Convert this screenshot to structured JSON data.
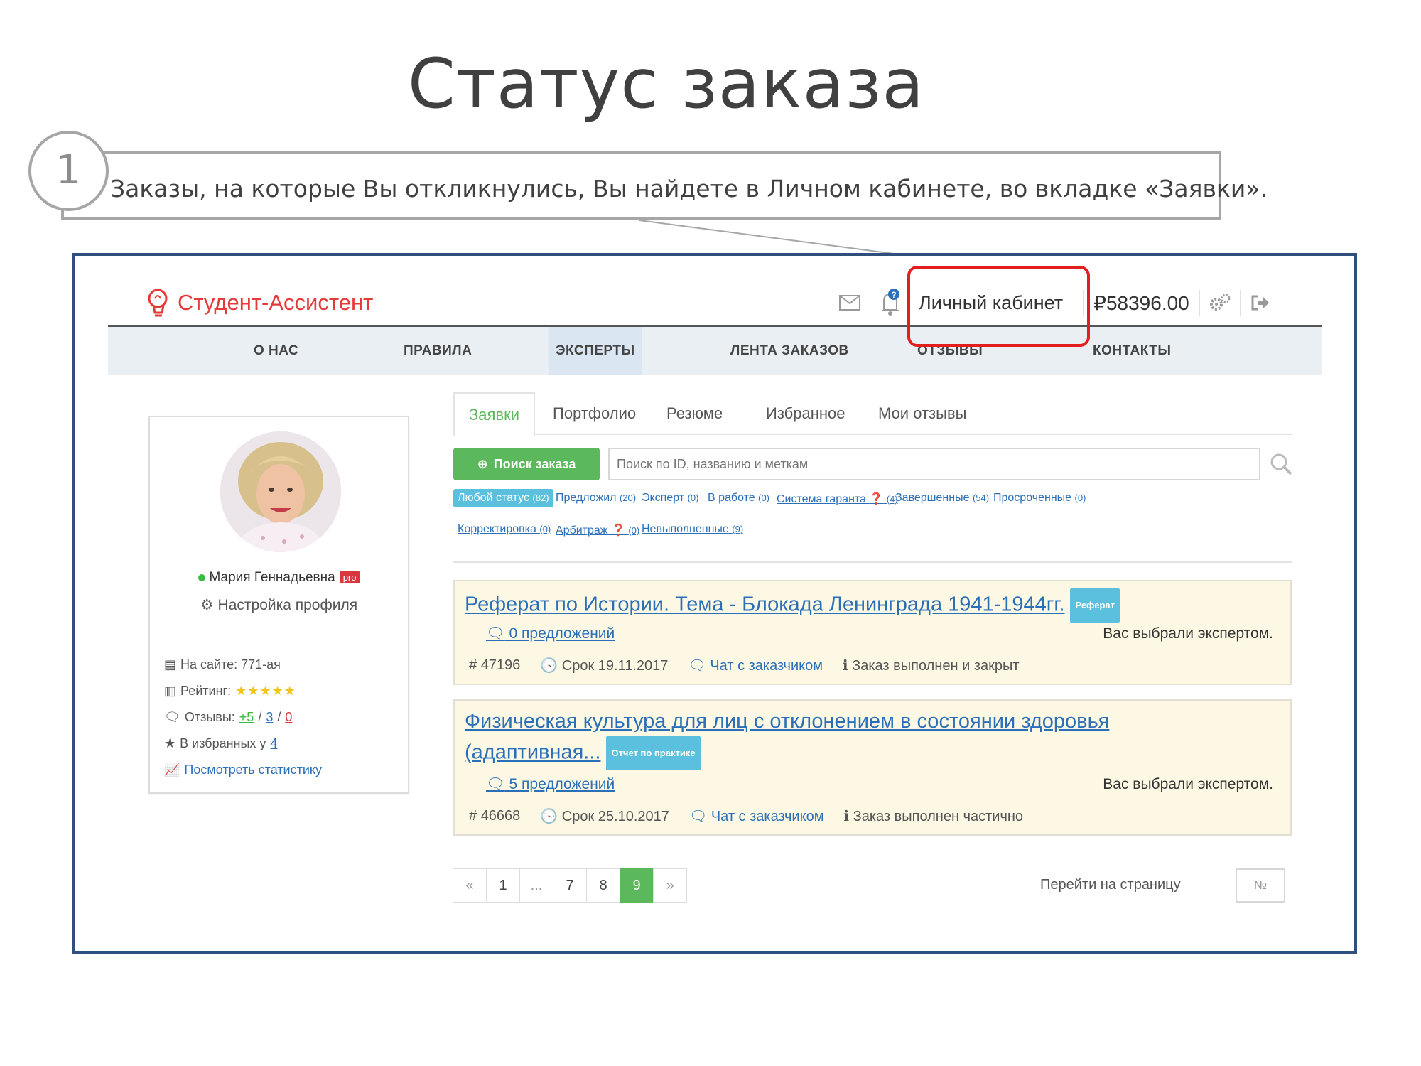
{
  "slide": {
    "title": "Статус заказа",
    "step_number": "1",
    "callout": "Заказы, на которые Вы откликнулись, Вы найдете в Личном кабинете,  во вкладке «Заявки»."
  },
  "header": {
    "logo_text": "Студент-Ассистент",
    "cabinet": "Личный кабинет",
    "balance": "₽58396.00",
    "icons": [
      "envelope-icon",
      "bell-icon",
      "gears-icon",
      "logout-icon"
    ]
  },
  "nav": [
    "О НАС",
    "ПРАВИЛА",
    "ЭКСПЕРТЫ",
    "ЛЕНТА ЗАКАЗОВ",
    "ОТЗЫВЫ",
    "КОНТАКТЫ"
  ],
  "profile": {
    "name": "Мария Геннадьевна",
    "badge": "pro",
    "settings": "Настройка профиля",
    "on_site": "На сайте: 771-ая",
    "rating_label": "Рейтинг:",
    "rating_stars": "★★★★★",
    "reviews_label": "Отзывы:",
    "reviews_pos": "+5",
    "reviews_neu": "3",
    "reviews_neg": "0",
    "favorites_label": "В избранных у",
    "favorites_count": "4",
    "stats_link": "Посмотреть статистику"
  },
  "tabs": [
    "Заявки",
    "Портфолио",
    "Резюме",
    "Избранное",
    "Мои отзывы"
  ],
  "search": {
    "button": "Поиск заказа",
    "placeholder": "Поиск по ID, названию и меткам"
  },
  "filters": [
    {
      "label": "Любой статус",
      "count": "(82)"
    },
    {
      "label": "Предложил",
      "count": "(20)"
    },
    {
      "label": "Эксперт",
      "count": "(0)"
    },
    {
      "label": "В работе",
      "count": "(0)"
    },
    {
      "label": "Система гаранта",
      "count": "(4)"
    },
    {
      "label": "Завершенные",
      "count": "(54)"
    },
    {
      "label": "Просроченные",
      "count": "(0)"
    },
    {
      "label": "Корректировка",
      "count": "(0)"
    },
    {
      "label": "Арбитраж",
      "count": "(0)"
    },
    {
      "label": "Невыполненные",
      "count": "(9)"
    }
  ],
  "orders": [
    {
      "title_line1": "Реферат по Истории. Тема - Блокада Ленинграда 1941-1944гг.",
      "title_line2": "",
      "tag": "Реферат",
      "offers": "0 предложений",
      "chosen": "Вас выбрали экспертом.",
      "id": "47196",
      "deadline": "Срок 19.11.2017",
      "chat": "Чат с заказчиком",
      "status": "Заказ выполнен и закрыт"
    },
    {
      "title_line1": "Физическая культура для лиц с отклонением в состоянии здоровья",
      "title_line2": "(адаптивная...",
      "tag": "Отчет по практике",
      "offers": "5 предложений",
      "chosen": "Вас выбрали экспертом.",
      "id": "46668",
      "deadline": "Срок 25.10.2017",
      "chat": "Чат с заказчиком",
      "status": "Заказ выполнен частично"
    }
  ],
  "pagination": {
    "pages": [
      "«",
      "1",
      "...",
      "7",
      "8",
      "9",
      "»"
    ],
    "active": "9",
    "goto_label": "Перейти на страницу",
    "goto_placeholder": "№"
  },
  "colors": {
    "accent_green": "#5cb85c",
    "link_blue": "#2a6fb8",
    "highlight_red": "#e21e1e",
    "frame_blue": "#2f4f7f",
    "brand_red": "#e53a3a"
  }
}
